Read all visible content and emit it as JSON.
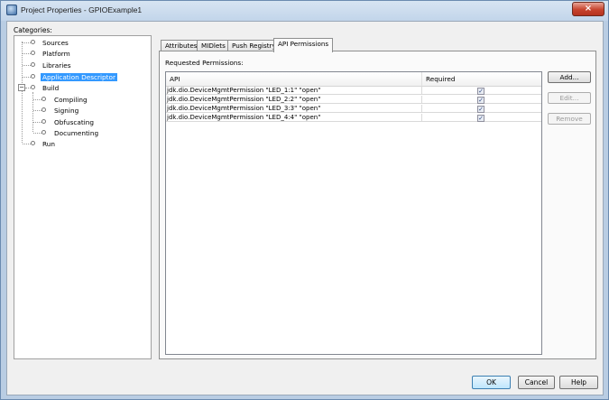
{
  "window": {
    "title": "Project Properties - GPIOExample1",
    "close_glyph": "×"
  },
  "categories": {
    "label": "Categories:",
    "items": [
      {
        "label": "Sources"
      },
      {
        "label": "Platform"
      },
      {
        "label": "Libraries"
      },
      {
        "label": "Application Descriptor",
        "selected": true
      },
      {
        "label": "Build",
        "expander": "−"
      },
      {
        "label": "Compiling"
      },
      {
        "label": "Signing"
      },
      {
        "label": "Obfuscating"
      },
      {
        "label": "Documenting"
      },
      {
        "label": "Run"
      }
    ]
  },
  "tabs": [
    {
      "label": "Attributes"
    },
    {
      "label": "MIDlets"
    },
    {
      "label": "Push Registry"
    },
    {
      "label": "API Permissions",
      "active": true
    }
  ],
  "permissions": {
    "label": "Requested Permissions:",
    "columns": {
      "api": "API",
      "required": "Required"
    },
    "check_glyph": "✓",
    "rows": [
      {
        "api": "jdk.dio.DeviceMgmtPermission \"LED_1:1\" \"open\"",
        "required": true
      },
      {
        "api": "jdk.dio.DeviceMgmtPermission \"LED_2:2\" \"open\"",
        "required": true
      },
      {
        "api": "jdk.dio.DeviceMgmtPermission \"LED_3:3\" \"open\"",
        "required": true
      },
      {
        "api": "jdk.dio.DeviceMgmtPermission \"LED_4:4\" \"open\"",
        "required": true
      }
    ],
    "buttons": {
      "add": "Add...",
      "edit": "Edit...",
      "remove": "Remove"
    }
  },
  "footer": {
    "ok": "OK",
    "cancel": "Cancel",
    "help": "Help"
  }
}
